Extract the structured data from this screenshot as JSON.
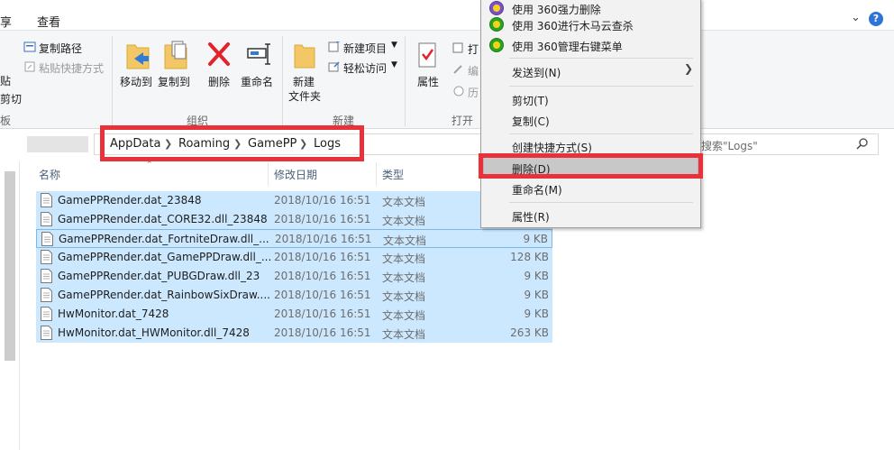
{
  "tabs": {
    "share": "享",
    "view": "查看"
  },
  "window": {
    "minimize": "—",
    "help": "?"
  },
  "ribbon": {
    "copy_path": "复制路径",
    "paste_shortcut": "粘贴快捷方式",
    "paste_partial": "贴",
    "cut_partial": "剪切",
    "clipboard_partial": "板",
    "move_to": "移动到",
    "copy_to": "复制到",
    "delete": "删除",
    "rename": "重命名",
    "organize": "组织",
    "new_folder_line1": "新建",
    "new_folder_line2": "文件夹",
    "new_item": "新建项目",
    "easy_access": "轻松访问",
    "new_group": "新建",
    "properties": "属性",
    "open_partial": "打",
    "edit_partial": "编",
    "history_partial": "历",
    "open_group": "打开"
  },
  "address": {
    "crumbs": [
      "AppData",
      "Roaming",
      "GamePP",
      "Logs"
    ],
    "search_placeholder": "搜索\"Logs\""
  },
  "columns": {
    "name": "名称",
    "date": "修改日期",
    "type": "类型"
  },
  "files": [
    {
      "name": "GamePPRender.dat_23848",
      "date": "2018/10/16 16:51",
      "type": "文本文档",
      "size": ""
    },
    {
      "name": "GamePPRender.dat_CORE32.dll_23848",
      "date": "2018/10/16 16:51",
      "type": "文本文档",
      "size": ""
    },
    {
      "name": "GamePPRender.dat_FortniteDraw.dll_...",
      "date": "2018/10/16 16:51",
      "type": "文本文档",
      "size": "9 KB"
    },
    {
      "name": "GamePPRender.dat_GamePPDraw.dll_...",
      "date": "2018/10/16 16:51",
      "type": "文本文档",
      "size": "128 KB"
    },
    {
      "name": "GamePPRender.dat_PUBGDraw.dll_23",
      "date": "2018/10/16 16:51",
      "type": "文本文档",
      "size": "9 KB"
    },
    {
      "name": "GamePPRender.dat_RainbowSixDraw....",
      "date": "2018/10/16 16:51",
      "type": "文本文档",
      "size": "9 KB"
    },
    {
      "name": "HwMonitor.dat_7428",
      "date": "2018/10/16 16:51",
      "type": "文本文档",
      "size": "9 KB"
    },
    {
      "name": "HwMonitor.dat_HWMonitor.dll_7428",
      "date": "2018/10/16 16:51",
      "type": "文本文档",
      "size": "263 KB"
    }
  ],
  "context_menu": {
    "item_360_force_delete": "使用 360强力删除",
    "item_360_scan": "使用 360进行木马云查杀",
    "item_360_manage": "使用 360管理右键菜单",
    "send_to": "发送到(N)",
    "cut": "剪切(T)",
    "copy": "复制(C)",
    "create_shortcut": "创建快捷方式(S)",
    "delete": "删除(D)",
    "rename": "重命名(M)",
    "properties": "属性(R)"
  },
  "colors": {
    "selection": "#cce8ff",
    "highlight_border": "#e8313a",
    "accent": "#2f75d6"
  }
}
